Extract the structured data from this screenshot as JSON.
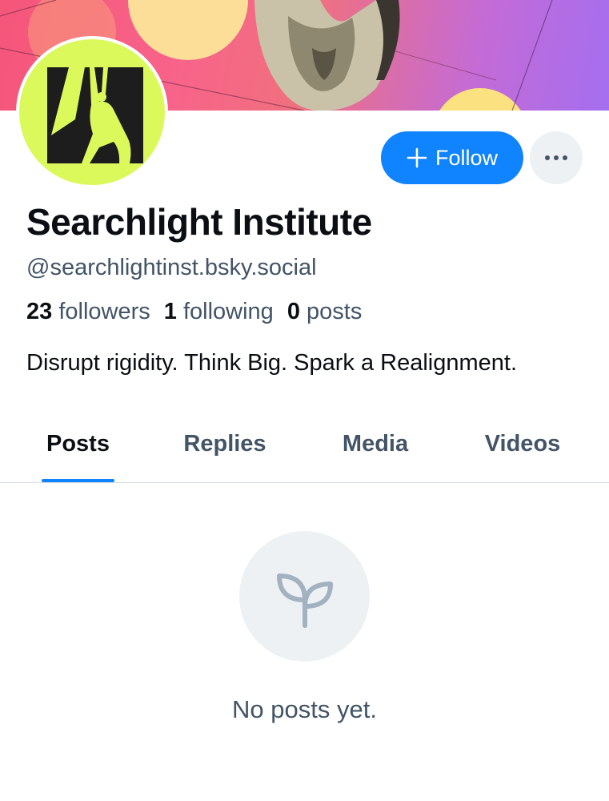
{
  "profile": {
    "display_name": "Searchlight Institute",
    "handle": "@searchlightinst.bsky.social",
    "bio": "Disrupt rigidity. Think Big. Spark a Realignment.",
    "stats": {
      "followers_count": "23",
      "followers_label": "followers",
      "following_count": "1",
      "following_label": "following",
      "posts_count": "0",
      "posts_label": "posts"
    }
  },
  "actions": {
    "follow_label": "Follow",
    "more_icon": "ellipsis-icon",
    "follow_icon": "plus-icon"
  },
  "tabs": [
    {
      "label": "Posts",
      "active": true
    },
    {
      "label": "Replies",
      "active": false
    },
    {
      "label": "Media",
      "active": false
    },
    {
      "label": "Videos",
      "active": false
    }
  ],
  "empty_state": {
    "icon": "sprout-icon",
    "message": "No posts yet."
  },
  "colors": {
    "accent": "#1083fe",
    "avatar_bg": "#dcf95c",
    "muted_text": "#425466",
    "primary_text": "#0b0f14"
  }
}
